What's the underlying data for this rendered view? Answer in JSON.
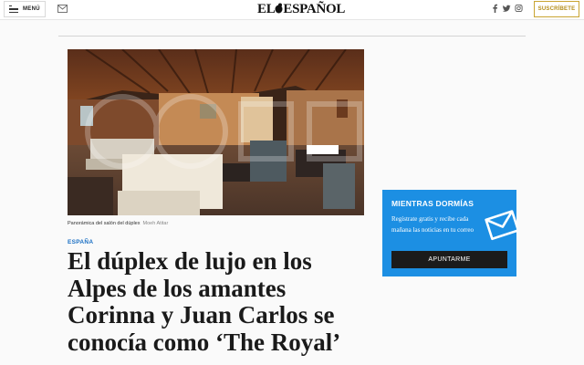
{
  "header": {
    "menu_label": "MENÚ",
    "logo_left": "EL",
    "logo_right": "ESPAÑOL",
    "subscribe_label": "SUSCRÍBETE",
    "icons": [
      "menu-icon",
      "mail-icon",
      "facebook-icon",
      "twitter-icon",
      "instagram-icon"
    ]
  },
  "article": {
    "photo_caption": "Panorámica del salón del dúplex",
    "photo_author": "Moeh Atitar",
    "section": "ESPAÑA",
    "headline": "El dúplex de lujo en los Alpes de los amantes Corinna y Juan Carlos se conocía como ‘The Royal’",
    "subhead": ""
  },
  "promo": {
    "title": "MIENTRAS DORMÍAS",
    "text": "Regístrate gratis y recibe cada mañana las noticias en tu correo",
    "button_label": "APUNTARME",
    "icon": "envelope-icon"
  },
  "colors": {
    "section_blue": "#1a6fc4",
    "promo_blue": "#1c8fe3",
    "subscribe_gold": "#c9a532",
    "button_dark": "#1b1b1b"
  }
}
